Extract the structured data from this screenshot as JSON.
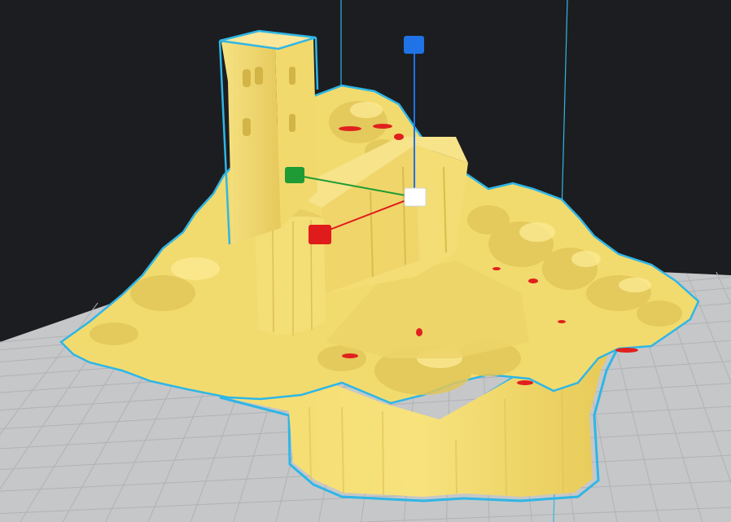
{
  "viewport": {
    "background": "#1c1d20",
    "plate_color": "#c6c7c9",
    "plate_grid_color": "#b1b2b5",
    "model_color": "#f2db6e",
    "model_shade": "#d9bd4e",
    "selection_outline": "#2fb6e6",
    "overhang_color": "#e0201e"
  },
  "gizmo": {
    "x_axis_color": "#e01b1b",
    "y_axis_color": "#1e9b34",
    "z_axis_color": "#1f73e6",
    "center_color": "#ffffff",
    "x_handle": "x-axis-handle-icon",
    "y_handle": "y-axis-handle-icon",
    "z_handle": "z-axis-handle-icon",
    "center_handle": "move-center-handle-icon"
  },
  "model": {
    "icon": "church-terrain-model-icon"
  }
}
